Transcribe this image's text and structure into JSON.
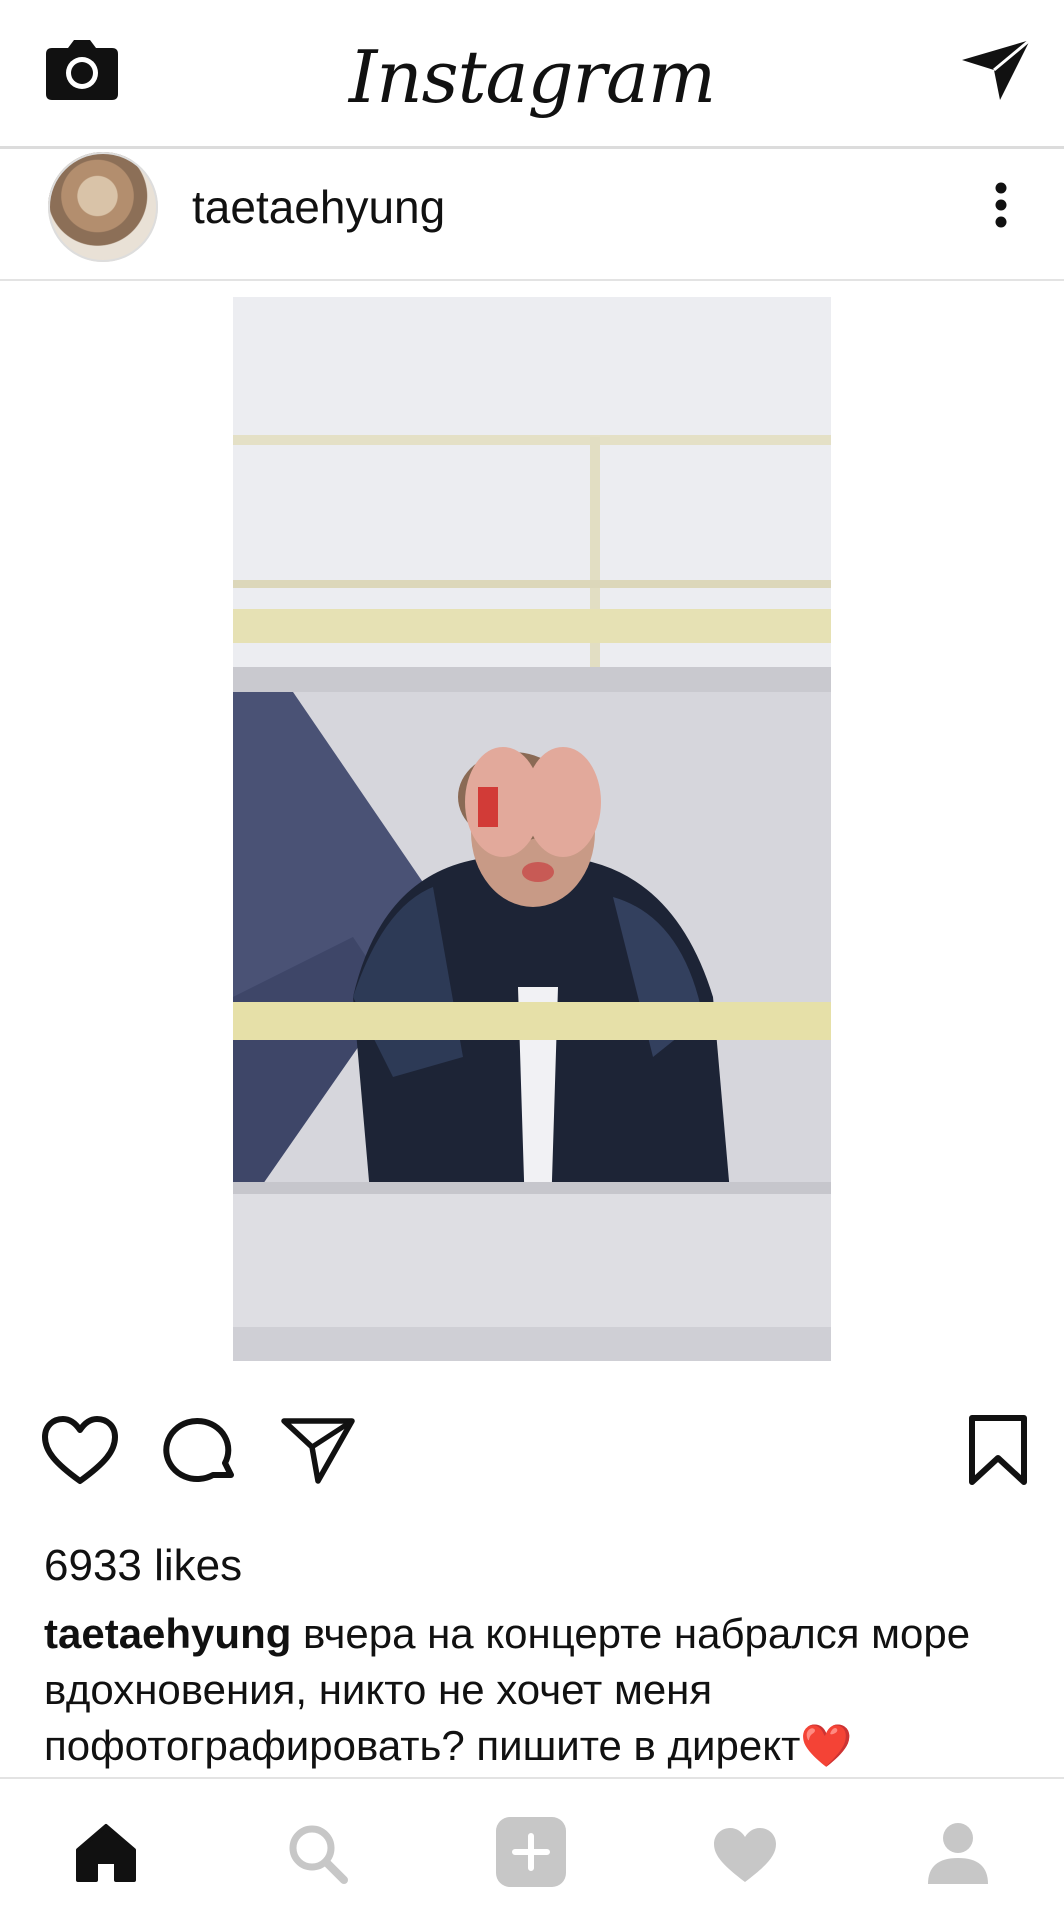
{
  "app": {
    "brand": "Instagram"
  },
  "top_bar": {
    "camera_icon": "camera-icon",
    "direct_icon": "paper-plane-icon"
  },
  "post": {
    "username": "taetaehyung",
    "more_icon": "more-vertical-icon",
    "photo_alt": "photo",
    "likes_text": "6933 likes",
    "caption_user": "taetaehyung",
    "caption_text": " вчера на концерте набрался море вдохновения, никто не хочет меня пофотографировать? пишите в директ",
    "caption_emoji": "❤️",
    "actions": {
      "like_icon": "heart-outline-icon",
      "comment_icon": "comment-bubble-icon",
      "share_icon": "paper-plane-outline-icon",
      "save_icon": "bookmark-outline-icon"
    }
  },
  "bottom_nav": {
    "items": [
      {
        "name": "home",
        "icon": "home-icon",
        "active": true
      },
      {
        "name": "search",
        "icon": "search-icon",
        "active": false
      },
      {
        "name": "new-post",
        "icon": "plus-square-icon",
        "active": false
      },
      {
        "name": "activity",
        "icon": "heart-icon",
        "active": false
      },
      {
        "name": "profile",
        "icon": "user-icon",
        "active": false
      }
    ]
  },
  "colors": {
    "accent_heart": "#d9261c",
    "inactive_icon": "#c7c7c7",
    "active_icon": "#111111"
  }
}
